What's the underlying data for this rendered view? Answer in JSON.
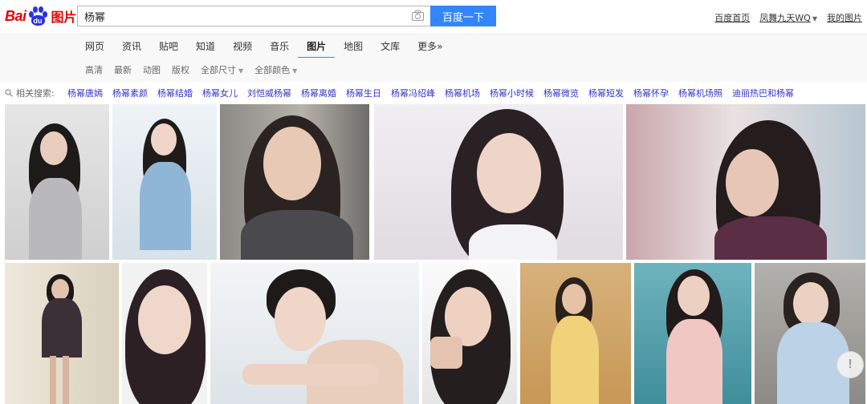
{
  "logo": {
    "bai": "Bai",
    "du": "du",
    "tupian": "图片"
  },
  "search": {
    "query": "杨幂",
    "button_label": "百度一下"
  },
  "top_links": {
    "home": "百度首页",
    "user": "凤舞九天WQ",
    "my_images": "我的图片"
  },
  "nav_tabs": [
    {
      "label": "网页"
    },
    {
      "label": "资讯"
    },
    {
      "label": "贴吧"
    },
    {
      "label": "知道"
    },
    {
      "label": "视频"
    },
    {
      "label": "音乐"
    },
    {
      "label": "图片",
      "active": true
    },
    {
      "label": "地图"
    },
    {
      "label": "文库"
    },
    {
      "label": "更多»"
    }
  ],
  "filters": {
    "hd": "高清",
    "latest": "最新",
    "animated": "动图",
    "copyright": "版权",
    "size": "全部尺寸",
    "color": "全部颜色"
  },
  "related": {
    "label": "相关搜索:",
    "items": [
      "杨幂唐嫣",
      "杨幂素颜",
      "杨幂结婚",
      "杨幂女儿",
      "刘恺威杨幂",
      "杨幂离婚",
      "杨幂生日",
      "杨幂冯绍峰",
      "杨幂机场",
      "杨幂小时候",
      "杨幂微览",
      "杨幂短发",
      "杨幂怀孕",
      "杨幂机场照",
      "迪丽热巴和杨幂"
    ]
  },
  "help_button": "!",
  "icons": {
    "camera": "camera-icon",
    "search": "search-icon",
    "caret": "caret-down-icon"
  },
  "colors": {
    "accent": "#3385ff",
    "brand_red": "#e10602",
    "brand_blue": "#2932e1",
    "link": "#3333cc"
  }
}
